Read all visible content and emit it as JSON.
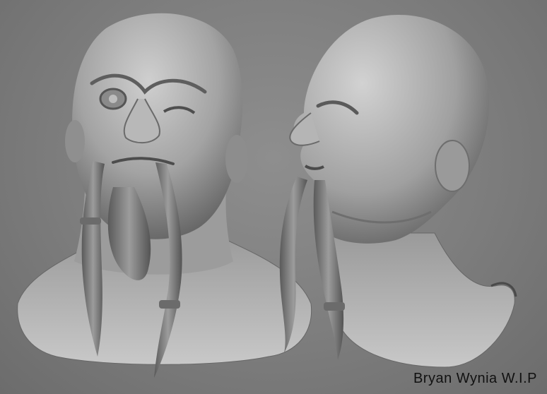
{
  "caption": {
    "text": "Bryan Wynia  W.I.P"
  },
  "views": [
    {
      "name": "front-three-quarter view"
    },
    {
      "name": "side profile view"
    }
  ],
  "colors": {
    "background": "#7d7d7d",
    "clay": "#a9a9a9",
    "clay_shadow": "#5a5a5a",
    "caption": "#111111"
  }
}
